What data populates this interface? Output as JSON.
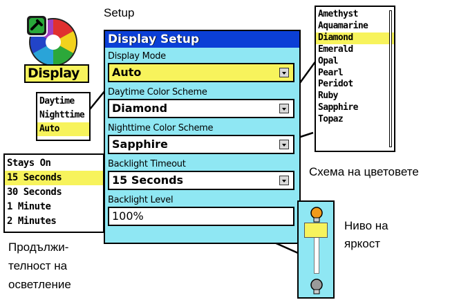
{
  "app": {
    "icon_name": "display-settings-icon",
    "label": "Display"
  },
  "top_caption": "Setup",
  "screen": {
    "title": "Display Setup",
    "fields": [
      {
        "label": "Display Mode",
        "value": "Auto"
      },
      {
        "label": "Daytime Color Scheme",
        "value": "Diamond"
      },
      {
        "label": "Nighttime Color Scheme",
        "value": "Sapphire"
      },
      {
        "label": "Backlight Timeout",
        "value": "15 Seconds"
      },
      {
        "label": "Backlight Level",
        "value": "100%"
      }
    ]
  },
  "mode_options": [
    "Daytime",
    "Nighttime",
    "Auto"
  ],
  "mode_selected": "Auto",
  "timeout_options": [
    "Stays On",
    "15 Seconds",
    "30 Seconds",
    "1 Minute",
    "2 Minutes"
  ],
  "timeout_selected": "15 Seconds",
  "scheme_options": [
    "Amethyst",
    "Aquamarine",
    "Diamond",
    "Emerald",
    "Opal",
    "Pearl",
    "Peridot",
    "Ruby",
    "Sapphire",
    "Topaz"
  ],
  "scheme_selected": "Diamond",
  "backlight_level_fraction": 1.0,
  "captions": {
    "color_scheme": "Схема на цветовете",
    "brightness_line1": "Ниво на",
    "brightness_line2": "яркост",
    "duration_line1": "Продължи-",
    "duration_line2": "телност на",
    "duration_line3": "осветление"
  },
  "colors": {
    "title_bar": "#0b3fd6",
    "screen_bg": "#8fe7f3",
    "highlight": "#f7f35c"
  }
}
